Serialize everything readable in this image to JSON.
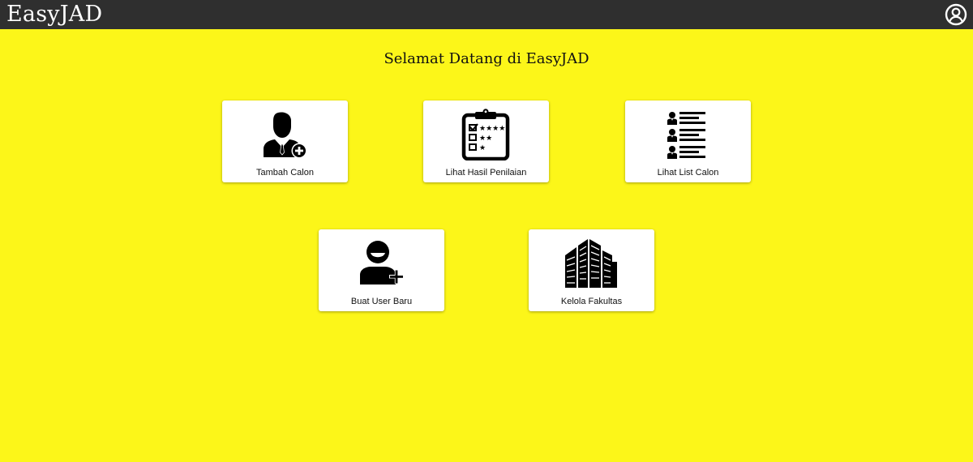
{
  "app": {
    "brand": "EasyJAD"
  },
  "header": {
    "profile_icon": "user-circle-icon"
  },
  "main": {
    "welcome": "Selamat Datang di EasyJAD",
    "menu": [
      {
        "label": "Tambah Calon",
        "icon": "person-add-icon"
      },
      {
        "label": "Lihat Hasil Penilaian",
        "icon": "clipboard-rating-icon"
      },
      {
        "label": "Lihat List Calon",
        "icon": "people-list-icon"
      },
      {
        "label": "Buat User Baru",
        "icon": "user-add-icon"
      },
      {
        "label": "Kelola Fakultas",
        "icon": "buildings-icon"
      }
    ]
  },
  "colors": {
    "background": "#fcf619",
    "topbar": "#2f2f2f",
    "card": "#ffffff",
    "text": "#111111"
  }
}
